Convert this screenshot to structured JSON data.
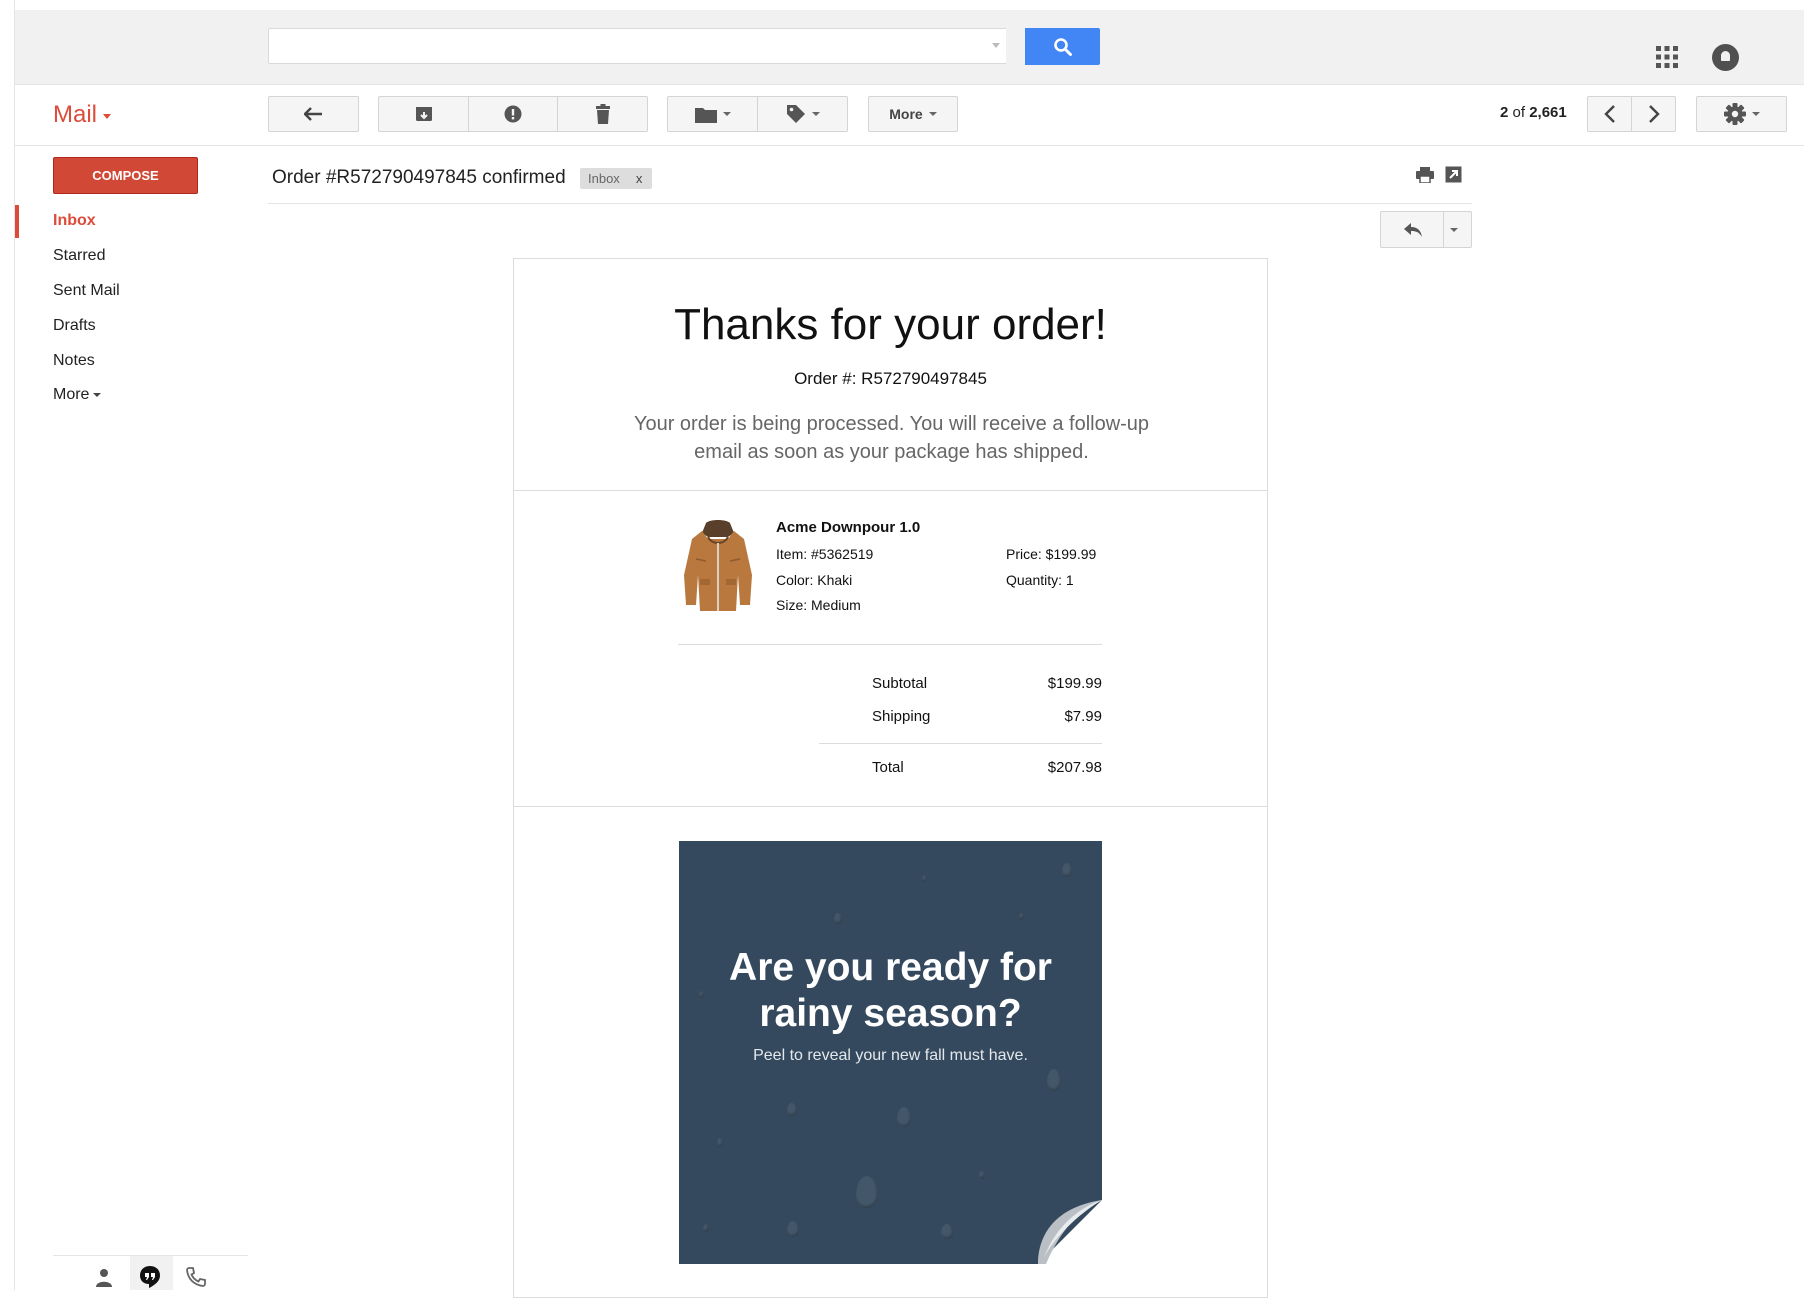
{
  "app": {
    "title": "Mail"
  },
  "search": {
    "placeholder": ""
  },
  "toolbar": {
    "more_label": "More"
  },
  "pager": {
    "current": "2",
    "of_label": "of",
    "total": "2,661"
  },
  "sidebar": {
    "compose_label": "COMPOSE",
    "items": [
      {
        "label": "Inbox",
        "active": true
      },
      {
        "label": "Starred"
      },
      {
        "label": "Sent Mail"
      },
      {
        "label": "Drafts"
      },
      {
        "label": "Notes"
      },
      {
        "label": "More"
      }
    ]
  },
  "message": {
    "subject": "Order #R572790497845 confirmed",
    "tag": {
      "label": "Inbox",
      "remove": "x"
    }
  },
  "email": {
    "heading": "Thanks for your order!",
    "order_number_label": "Order #:",
    "order_number": "R572790497845",
    "processing_text": "Your order is being processed. You will receive a follow-up email as soon as your package has shipped.",
    "product": {
      "name": "Acme Downpour 1.0",
      "item": "Item: #5362519",
      "color": "Color: Khaki",
      "size": "Size: Medium",
      "price": "Price: $199.99",
      "quantity": "Quantity: 1"
    },
    "summary": {
      "subtotal_label": "Subtotal",
      "subtotal": "$199.99",
      "shipping_label": "Shipping",
      "shipping": "$7.99",
      "total_label": "Total",
      "total": "$207.98"
    },
    "promo": {
      "title_line1": "Are you ready for",
      "title_line2": "rainy season?",
      "subtitle": "Peel to reveal your new fall must have."
    }
  },
  "colors": {
    "accent": "#dd4b39",
    "search_button": "#4285f4",
    "promo_bg": "#34495e"
  }
}
